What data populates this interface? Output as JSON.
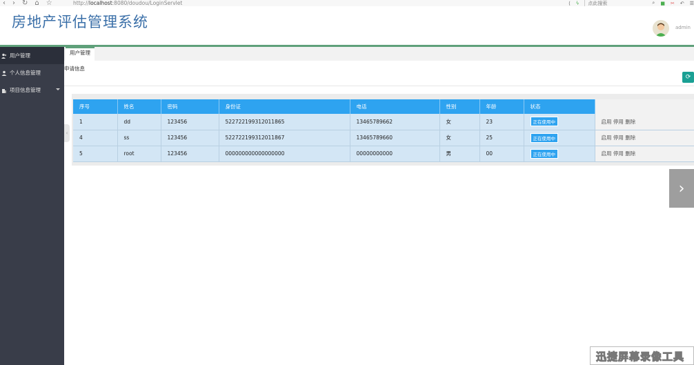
{
  "browser": {
    "url_prefix": "http://",
    "url_host": "localhost",
    "url_rest": ":8080/doudou/LoginServlet",
    "search_placeholder": "点此搜索"
  },
  "header": {
    "title": "房地产评估管理系统",
    "username": "admin"
  },
  "sidebar": {
    "items": [
      {
        "label": "用户管理"
      },
      {
        "label": "个人信息管理"
      },
      {
        "label": "项目信息管理"
      }
    ]
  },
  "tabs": [
    {
      "label": "用户管理"
    }
  ],
  "main": {
    "section_label": "申请信息"
  },
  "table": {
    "headers": [
      "序号",
      "姓名",
      "密码",
      "身份证",
      "电话",
      "性别",
      "年龄",
      "状态"
    ],
    "rows": [
      {
        "id": "1",
        "name": "dd",
        "password": "123456",
        "idcard": "522722199312011865",
        "phone": "13465789662",
        "gender": "女",
        "age": "23",
        "status": "正在使用中",
        "actions": "启用 停用 删除"
      },
      {
        "id": "4",
        "name": "ss",
        "password": "123456",
        "idcard": "522722199312011867",
        "phone": "13465789660",
        "gender": "女",
        "age": "25",
        "status": "正在使用中",
        "actions": "启用 停用 删除"
      },
      {
        "id": "5",
        "name": "root",
        "password": "123456",
        "idcard": "000000000000000000",
        "phone": "00000000000",
        "gender": "男",
        "age": "00",
        "status": "正在使用中",
        "actions": "启用 停用 删除"
      }
    ]
  },
  "watermark": "迅捷屏幕录像工具",
  "colors": {
    "accent": "#2ea3f0",
    "sidebar": "#393d49",
    "header_line": "#5fa07a",
    "title": "#3a6fa8"
  }
}
